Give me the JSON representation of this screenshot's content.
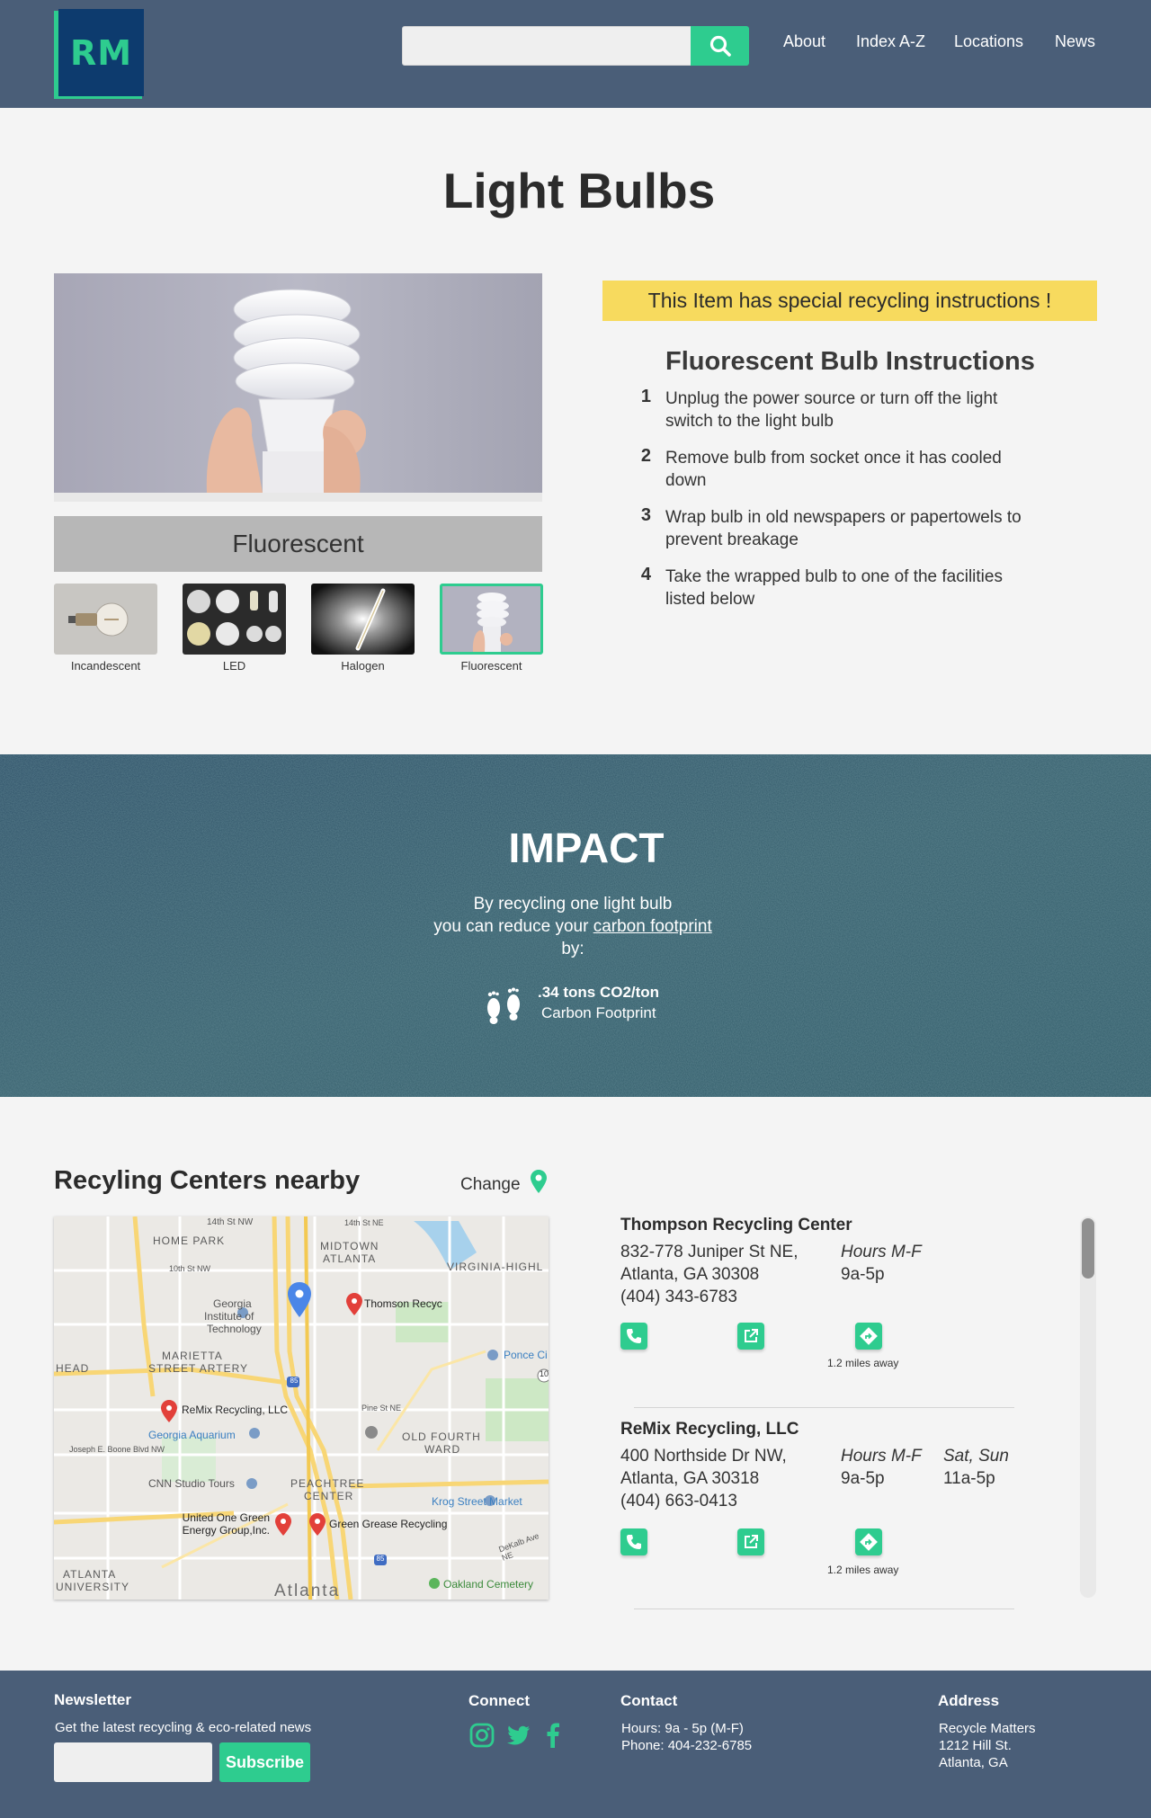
{
  "header": {
    "logo_text": "RM",
    "search": {
      "placeholder": "",
      "value": ""
    },
    "nav": [
      "About",
      "Index A-Z",
      "Locations",
      "News"
    ]
  },
  "page_title": "Light Bulbs",
  "product": {
    "selected_label": "Fluorescent",
    "variants": [
      "Incandescent",
      "LED",
      "Halogen",
      "Fluorescent"
    ],
    "selected_index": 3
  },
  "instructions": {
    "notice": "This Item has special recycling instructions !",
    "title": "Fluorescent Bulb Instructions",
    "steps": [
      {
        "num": "1",
        "text": "Unplug the power source or turn off the light switch to the light bulb"
      },
      {
        "num": "2",
        "text": "Remove bulb from socket once it has cooled down"
      },
      {
        "num": "3",
        "text": "Wrap bulb in old newspapers or papertowels to prevent breakage"
      },
      {
        "num": "4",
        "text": "Take the wrapped bulb to one of the facilities listed below"
      }
    ]
  },
  "impact": {
    "title": "IMPACT",
    "line1": "By recycling one light bulb",
    "line2_prefix": "you can reduce your",
    "line2_link": "carbon footprint",
    "line3": "by:",
    "value": ".34 tons CO2/ton",
    "value_label": "Carbon Footprint"
  },
  "centers": {
    "title": "Recyling Centers nearby",
    "change_label": "Change",
    "map": {
      "areas": [
        "HOME PARK",
        "MIDTOWN",
        "ATLANTA",
        "VIRGINIA-HIGHL",
        "MARIETTA",
        "STREET ARTERY",
        "HEAD",
        "OLD FOURTH",
        "WARD",
        "PEACHTREE",
        "CENTER",
        "ATLANTA",
        "UNIVERSITY",
        "Atlanta"
      ],
      "streets": [
        "14th St NW",
        "10th St NW",
        "Joseph E. Boone Blvd NW",
        "Pine St NE",
        "DeKalb Ave NE",
        "14th St NE"
      ],
      "places": [
        "Georgia",
        "Institute of",
        "Technology",
        "CNN Studio Tours",
        "Krog Street Market",
        "Oakland Cemetery"
      ],
      "water_places": [
        "Georgia Aquarium",
        "Ponce Ci"
      ],
      "pins": [
        "Thomson Recyc",
        "ReMix Recycling, LLC",
        "United One Green",
        "Energy Group,Inc.",
        "Green Grease Recycling"
      ],
      "highway_shields": [
        "85",
        "85",
        "10"
      ]
    },
    "list": [
      {
        "name": "Thompson Recycling Center",
        "address1": "832-778 Juniper St NE,",
        "address2": "Atlanta, GA 30308",
        "phone": "(404) 343-6783",
        "hours_label": "Hours M-F",
        "hours": "9a-5p",
        "distance": "1.2 miles away"
      },
      {
        "name": "ReMix Recycling, LLC",
        "address1": "400 Northside Dr NW,",
        "address2": "Atlanta, GA 30318",
        "phone": "(404) 663-0413",
        "hours_label": "Hours M-F",
        "hours": "9a-5p",
        "weekend_label": "Sat, Sun",
        "weekend_hours": "11a-5p",
        "distance": "1.2 miles away"
      }
    ]
  },
  "footer": {
    "newsletter_title": "Newsletter",
    "newsletter_text": "Get the latest recycling & eco-related news",
    "subscribe_label": "Subscribe",
    "connect_title": "Connect",
    "contact_title": "Contact",
    "contact_hours": "Hours: 9a - 5p (M-F)",
    "contact_phone": "Phone: 404-232-6785",
    "address_title": "Address",
    "address_lines": [
      "Recycle Matters",
      "1212 Hill St.",
      "Atlanta, GA"
    ]
  },
  "colors": {
    "header_bg": "#4a5e78",
    "accent": "#2ecc8f",
    "notice_bg": "#f7da5e",
    "impact_bg": "#32586a",
    "map_pin_red": "#e2403a",
    "map_pin_blue": "#4a86e8"
  }
}
